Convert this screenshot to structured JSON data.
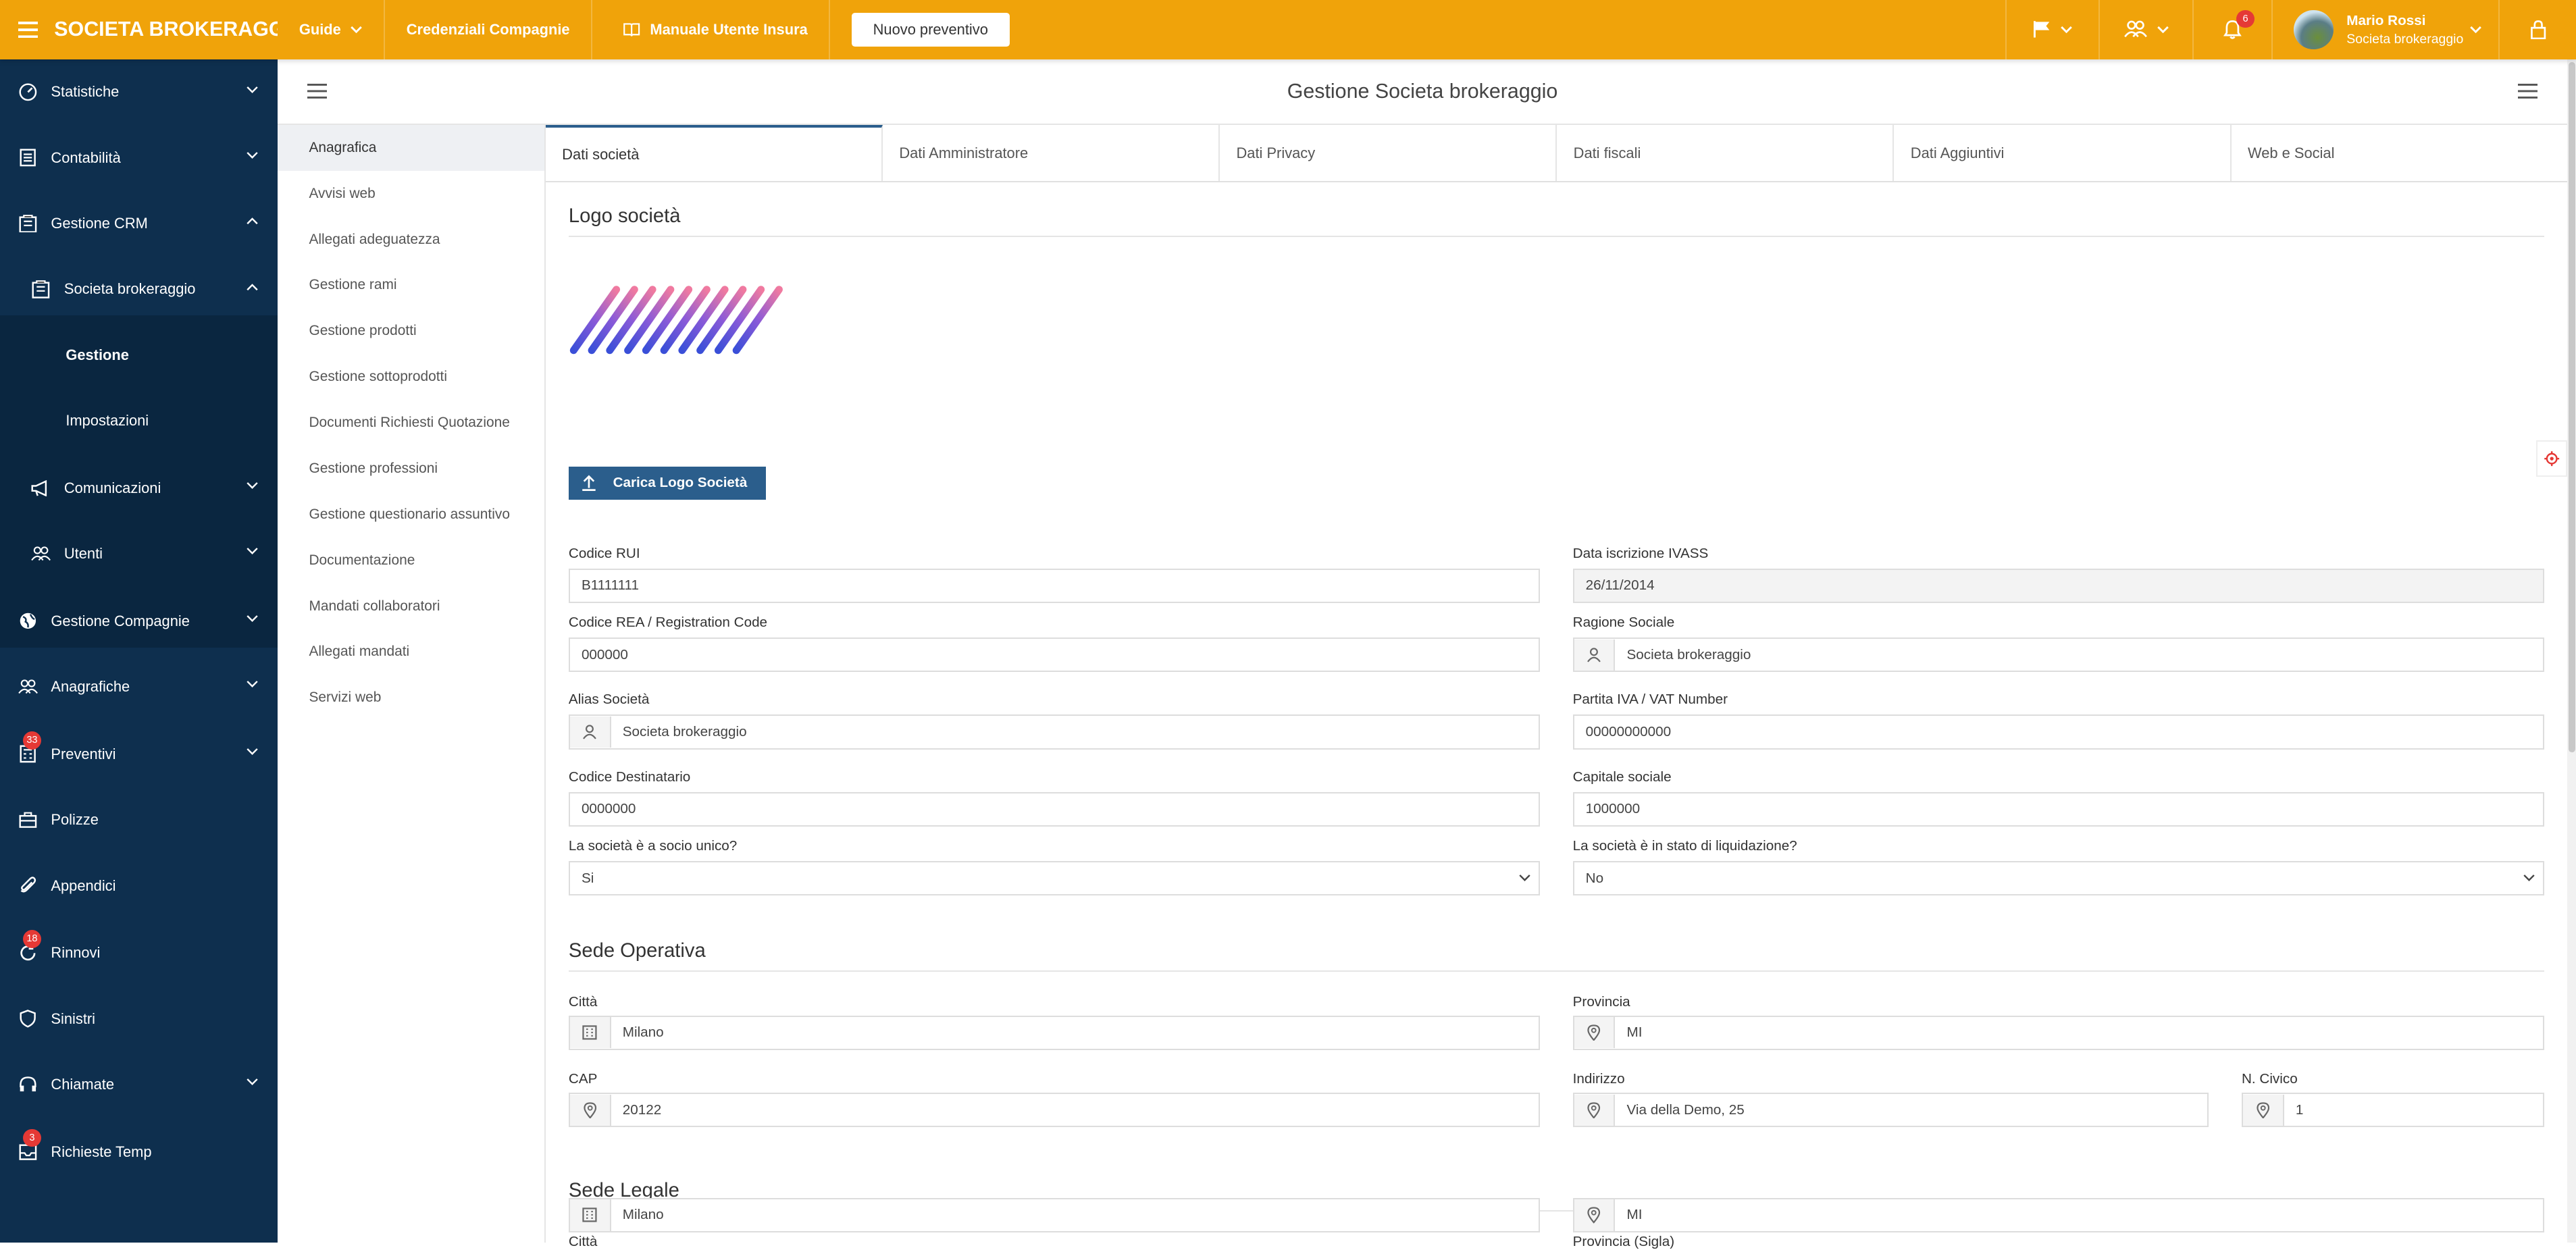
{
  "header": {
    "brand": "SOCIETA BROKERAGG...",
    "nav": [
      "Guide",
      "Credenziali Compagnie",
      "Manuale Utente Insura"
    ],
    "new_quote": "Nuovo preventivo",
    "notifications_count": "6",
    "user_name": "Mario Rossi",
    "user_role": "Societa brokeraggio"
  },
  "sidebar": {
    "items": [
      {
        "label": "Statistiche",
        "icon": "gauge-icon"
      },
      {
        "label": "Contabilità",
        "icon": "ledger-icon"
      },
      {
        "label": "Gestione CRM",
        "icon": "building-icon"
      },
      {
        "label": "Societa brokeraggio",
        "icon": "building-icon"
      },
      {
        "label": "Gestione"
      },
      {
        "label": "Impostazioni"
      },
      {
        "label": "Comunicazioni",
        "icon": "megaphone-icon"
      },
      {
        "label": "Utenti",
        "icon": "users-icon"
      },
      {
        "label": "Gestione Compagnie",
        "icon": "globe-icon"
      },
      {
        "label": "Anagrafiche",
        "icon": "users-icon"
      },
      {
        "label": "Preventivi",
        "icon": "calculator-icon",
        "badge": "33"
      },
      {
        "label": "Polizze",
        "icon": "briefcase-icon"
      },
      {
        "label": "Appendici",
        "icon": "paperclip-icon"
      },
      {
        "label": "Rinnovi",
        "icon": "refresh-icon",
        "badge": "18"
      },
      {
        "label": "Sinistri",
        "icon": "shield-icon"
      },
      {
        "label": "Chiamate",
        "icon": "headset-icon"
      },
      {
        "label": "Richieste Temp",
        "icon": "inbox-icon",
        "badge": "3"
      }
    ]
  },
  "page": {
    "title": "Gestione Societa brokeraggio"
  },
  "left_menu": [
    "Anagrafica",
    "Avvisi web",
    "Allegati adeguatezza",
    "Gestione rami",
    "Gestione prodotti",
    "Gestione sottoprodotti",
    "Documenti Richiesti Quotazione",
    "Gestione professioni",
    "Gestione questionario assuntivo",
    "Documentazione",
    "Mandati collaboratori",
    "Allegati mandati",
    "Servizi web"
  ],
  "tabs": [
    "Dati società",
    "Dati Amministratore",
    "Dati Privacy",
    "Dati fiscali",
    "Dati Aggiuntivi",
    "Web e Social"
  ],
  "form": {
    "logo_title": "Logo società",
    "upload_label": "Carica Logo Società",
    "codice_rui": {
      "label": "Codice RUI",
      "value": "B1111111"
    },
    "data_iscrizione": {
      "label": "Data iscrizione IVASS",
      "value": "26/11/2014"
    },
    "codice_rea": {
      "label": "Codice REA / Registration Code",
      "value": "000000"
    },
    "ragione_sociale": {
      "label": "Ragione Sociale",
      "value": "Societa brokeraggio"
    },
    "alias": {
      "label": "Alias Società",
      "value": "Societa brokeraggio"
    },
    "partita_iva": {
      "label": "Partita IVA / VAT Number",
      "value": "00000000000"
    },
    "codice_destinatario": {
      "label": "Codice Destinatario",
      "value": "0000000"
    },
    "capitale_sociale": {
      "label": "Capitale sociale",
      "value": "1000000"
    },
    "socio_unico": {
      "label": "La società è a socio unico?",
      "value": "Si"
    },
    "liquidazione": {
      "label": "La società è in stato di liquidazione?",
      "value": "No"
    },
    "sede_operativa_title": "Sede Operativa",
    "op_citta": {
      "label": "Città",
      "value": "Milano"
    },
    "op_provincia": {
      "label": "Provincia",
      "value": "MI"
    },
    "op_cap": {
      "label": "CAP",
      "value": "20122"
    },
    "op_indirizzo": {
      "label": "Indirizzo",
      "value": "Via della Demo, 25"
    },
    "op_civico": {
      "label": "N. Civico",
      "value": "1"
    },
    "sede_legale_title": "Sede Legale",
    "leg_citta": {
      "label": "Città",
      "value": "Milano"
    },
    "leg_provincia": {
      "label": "Provincia (Sigla)",
      "value": "MI"
    }
  }
}
